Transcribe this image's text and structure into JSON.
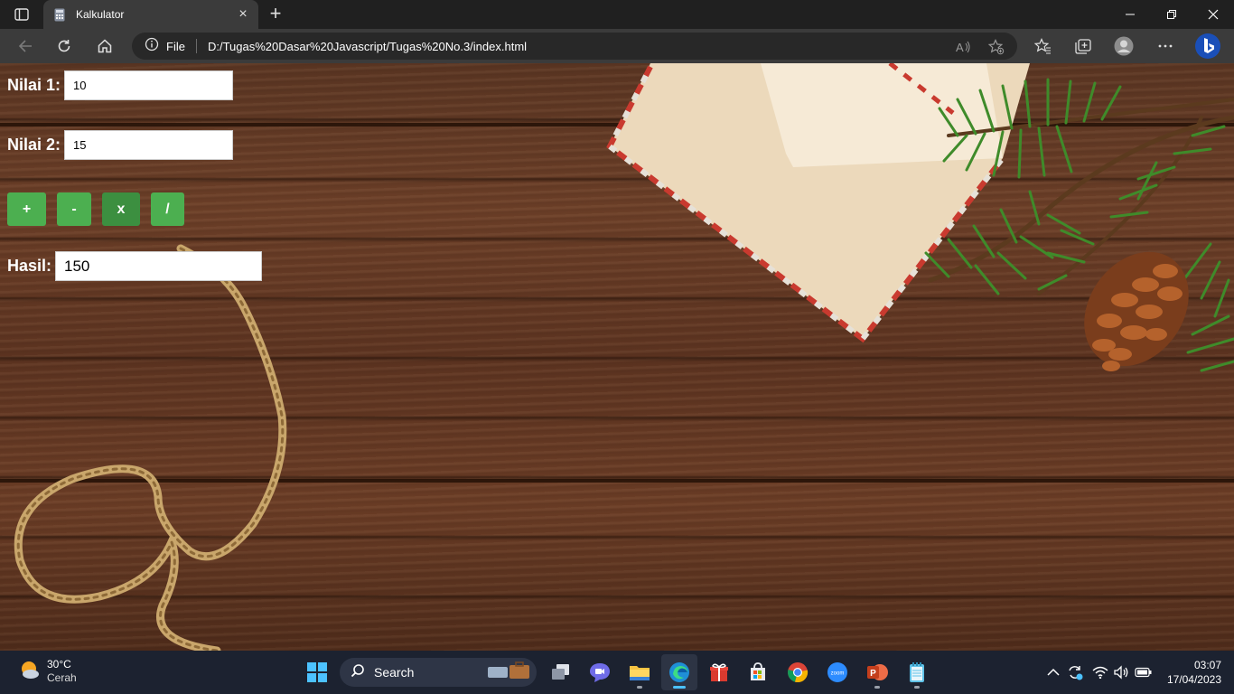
{
  "browser": {
    "tab_title": "Kalkulator",
    "address_scheme": "File",
    "address_url": "D:/Tugas%20Dasar%20Javascript/Tugas%20No.3/index.html"
  },
  "calculator": {
    "nilai1_label": "Nilai 1:",
    "nilai1_value": "10",
    "nilai2_label": "Nilai 2:",
    "nilai2_value": "15",
    "ops": {
      "add": "+",
      "subtract": "-",
      "multiply": "x",
      "divide": "/"
    },
    "active_op": "multiply",
    "hasil_label": "Hasil:",
    "hasil_value": "150",
    "button_color": "#4caf50"
  },
  "taskbar": {
    "weather_temp": "30°C",
    "weather_condition": "Cerah",
    "search_label": "Search",
    "time": "03:07",
    "date": "17/04/2023",
    "apps": [
      "start",
      "search",
      "suitcase-widget",
      "task-view",
      "teams-chat",
      "file-explorer",
      "edge",
      "gift",
      "microsoft-store",
      "chrome",
      "zoom",
      "powerpoint",
      "notepad"
    ]
  }
}
